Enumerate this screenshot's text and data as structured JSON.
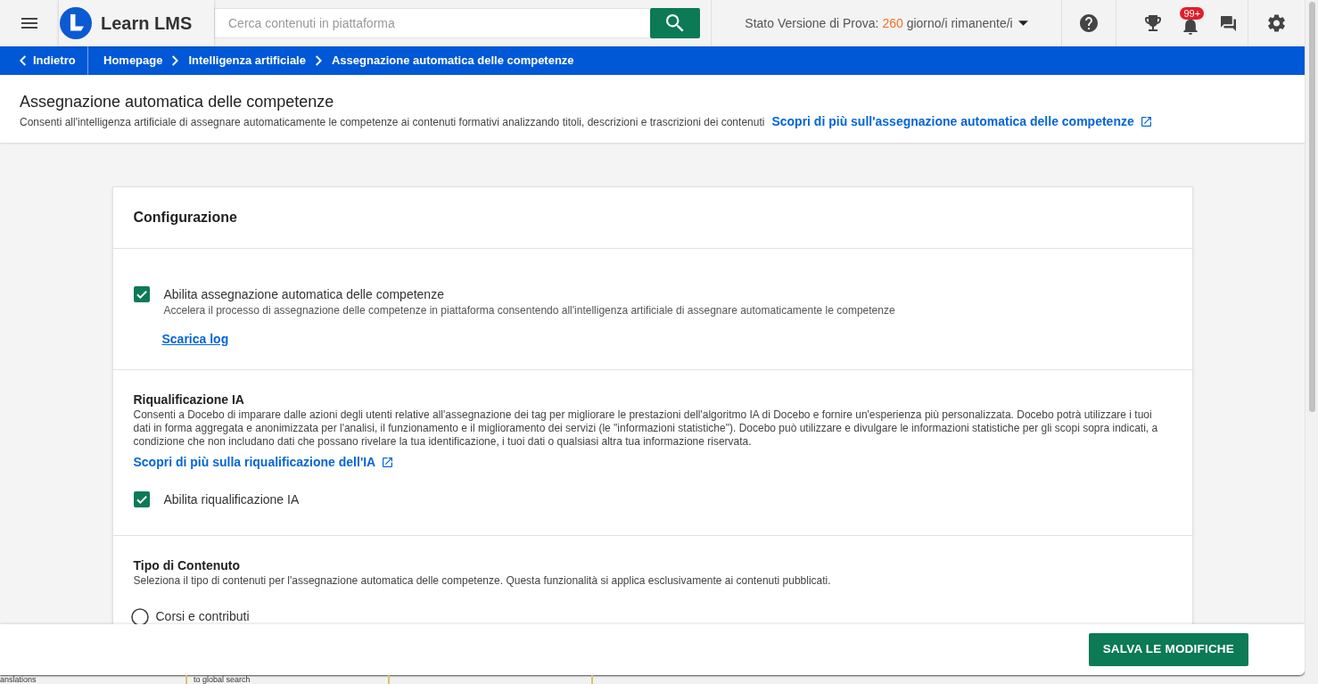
{
  "topbar": {
    "logo_text": "Learn LMS",
    "search": {
      "placeholder": "Cerca contenuti in piattaforma"
    },
    "trial": {
      "label": "Stato Versione di Prova:",
      "days": "260",
      "suffix": "giorno/i rimanente/i"
    },
    "notifications_count": "99+"
  },
  "breadcrumb": {
    "back": "Indietro",
    "items": [
      {
        "label": "Homepage"
      },
      {
        "label": "Intelligenza artificiale"
      },
      {
        "label": "Assegnazione automatica delle competenze"
      }
    ]
  },
  "page_header": {
    "title": "Assegnazione automatica delle competenze",
    "description": "Consenti all'intelligenza artificiale di assegnare automaticamente le competenze ai contenuti formativi analizzando titoli, descrizioni e trascrizioni dei contenuti",
    "link": "Scopri di più sull'assegnazione automatica delle competenze"
  },
  "card": {
    "title": "Configurazione",
    "sections": [
      {
        "items": [
          {
            "kind": "checkbox",
            "label": "Abilita assegnazione automatica delle competenze",
            "description": "Accelera il processo di assegnazione delle competenze in piattaforma consentendo all'intelligenza artificiale di assegnare automaticamente le competenze",
            "checked": true
          },
          {
            "kind": "download_link",
            "label": "Scarica log"
          }
        ]
      },
      {
        "title": "Riqualificazione IA",
        "description": "Consenti a Docebo di imparare dalle azioni degli utenti relative all'assegnazione dei tag per migliorare le prestazioni dell'algoritmo IA di Docebo e fornire un'esperienza più personalizzata. Docebo potrà utilizzare i tuoi dati in forma aggregata e anonimizzata per l'analisi, il funzionamento e il miglioramento dei servizi (le \"informazioni statistiche\"). Docebo può utilizzare e divulgare le informazioni statistiche per gli scopi sopra indicati, a condizione che non includano dati che possano rivelare la tua identificazione, i tuoi dati o qualsiasi altra tua informazione riservata.",
        "items": [
          {
            "kind": "external_link",
            "label": "Scopri di più sulla riqualificazione dell'IA"
          },
          {
            "kind": "checkbox",
            "label": "Abilita riqualificazione IA",
            "checked": true
          }
        ]
      },
      {
        "title": "Tipo di Contenuto",
        "description": "Seleziona il tipo di contenuti per l'assegnazione automatica delle competenze. Questa funzionalità si applica esclusivamente ai contenuti pubblicati.",
        "items": [
          {
            "kind": "radio",
            "label": "Corsi e contributi",
            "selected": false
          }
        ]
      }
    ]
  },
  "footer": {
    "save_button": "SALVA LE MODIFICHE"
  },
  "background_page": {
    "texts": [
      "anslations",
      "to global search"
    ]
  }
}
